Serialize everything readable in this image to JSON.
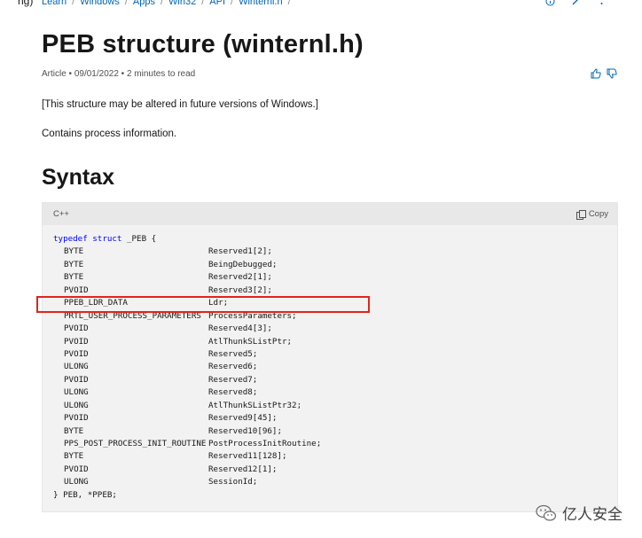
{
  "top_fragment": "ng)",
  "breadcrumb": [
    "Learn",
    "Windows",
    "Apps",
    "Win32",
    "API",
    "Winternl.h"
  ],
  "title": "PEB structure (winternl.h)",
  "meta": "Article • 09/01/2022 • 2 minutes to read",
  "para1": "[This structure may be altered in future versions of Windows.]",
  "para2": "Contains process information.",
  "section_title": "Syntax",
  "code": {
    "lang": "C++",
    "copy_label": "Copy",
    "first_line_kw": "typedef struct",
    "first_line_rest": " _PEB {",
    "fields": [
      {
        "type": "BYTE",
        "name": "Reserved1[2];"
      },
      {
        "type": "BYTE",
        "name": "BeingDebugged;"
      },
      {
        "type": "BYTE",
        "name": "Reserved2[1];"
      },
      {
        "type": "PVOID",
        "name": "Reserved3[2];"
      },
      {
        "type": "PPEB_LDR_DATA",
        "name": "Ldr;"
      },
      {
        "type": "PRTL_USER_PROCESS_PARAMETERS",
        "name": "ProcessParameters;"
      },
      {
        "type": "PVOID",
        "name": "Reserved4[3];"
      },
      {
        "type": "PVOID",
        "name": "AtlThunkSListPtr;"
      },
      {
        "type": "PVOID",
        "name": "Reserved5;"
      },
      {
        "type": "ULONG",
        "name": "Reserved6;"
      },
      {
        "type": "PVOID",
        "name": "Reserved7;"
      },
      {
        "type": "ULONG",
        "name": "Reserved8;"
      },
      {
        "type": "ULONG",
        "name": "AtlThunkSListPtr32;"
      },
      {
        "type": "PVOID",
        "name": "Reserved9[45];"
      },
      {
        "type": "BYTE",
        "name": "Reserved10[96];"
      },
      {
        "type": "PPS_POST_PROCESS_INIT_ROUTINE",
        "name": "PostProcessInitRoutine;"
      },
      {
        "type": "BYTE",
        "name": "Reserved11[128];"
      },
      {
        "type": "PVOID",
        "name": "Reserved12[1];"
      },
      {
        "type": "ULONG",
        "name": "SessionId;"
      }
    ],
    "last_line": "} PEB, *PPEB;"
  },
  "watermark": "亿人安全",
  "colors": {
    "link": "#0065b3",
    "keyword": "#0101fd",
    "highlight": "#e3241b"
  }
}
